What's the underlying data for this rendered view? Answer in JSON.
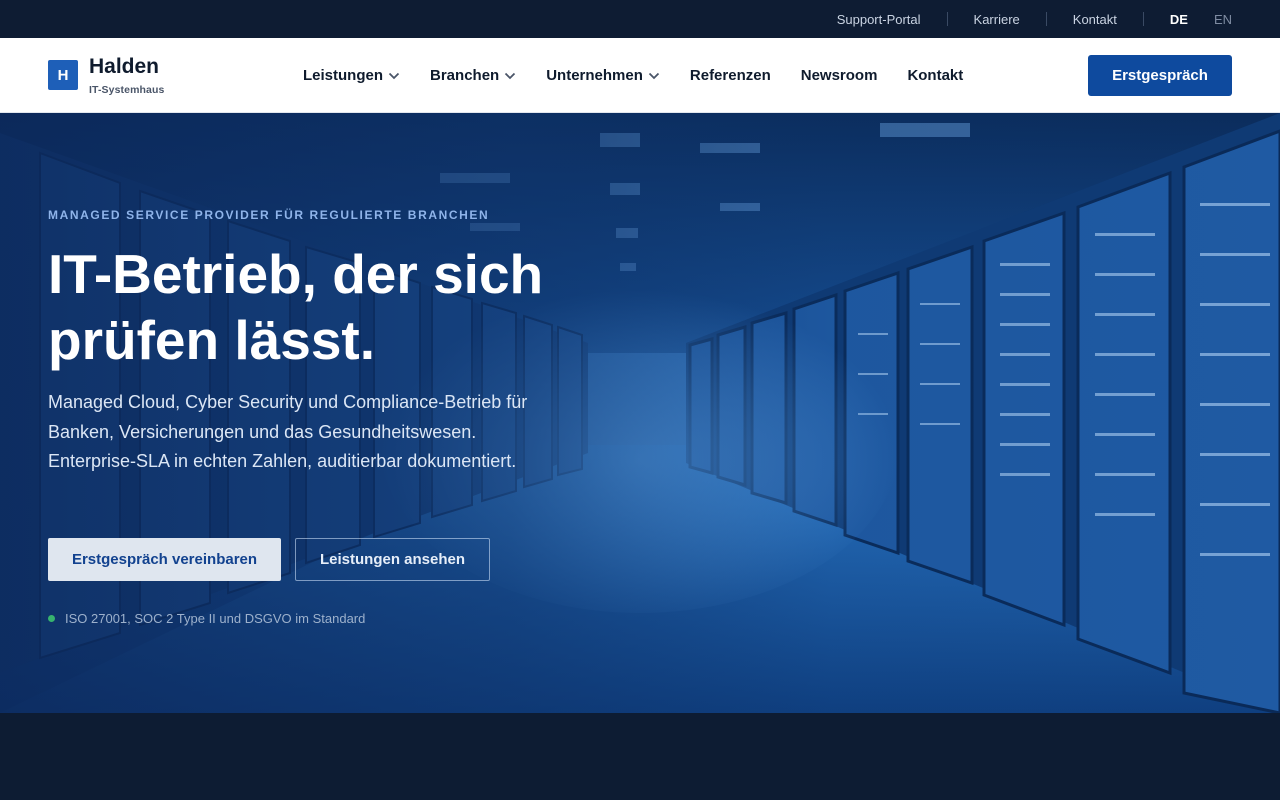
{
  "utility_nav": {
    "links": [
      "Support-Portal",
      "Karriere",
      "Kontakt"
    ],
    "languages": [
      {
        "code": "DE",
        "active": true
      },
      {
        "code": "EN",
        "active": false
      }
    ]
  },
  "brand": {
    "mark": "H",
    "name": "Halden",
    "tagline": "IT-Systemhaus"
  },
  "main_nav": [
    {
      "label": "Leistungen",
      "has_dropdown": true
    },
    {
      "label": "Branchen",
      "has_dropdown": true
    },
    {
      "label": "Unternehmen",
      "has_dropdown": true
    },
    {
      "label": "Referenzen",
      "has_dropdown": false
    },
    {
      "label": "Newsroom",
      "has_dropdown": false
    },
    {
      "label": "Kontakt",
      "has_dropdown": false
    }
  ],
  "header_cta": "Erstgespräch",
  "hero": {
    "eyebrow": "MANAGED SERVICE PROVIDER FÜR REGULIERTE BRANCHEN",
    "headline_line1": "IT-Betrieb, der sich",
    "headline_line2": "prüfen lässt.",
    "lead": "Managed Cloud, Cyber Security und Compliance-Betrieb für Banken, Versicherungen und das Gesundheitswesen. Enterprise-SLA in echten Zahlen, auditierbar dokumentiert.",
    "primary_button": "Erstgespräch vereinbaren",
    "secondary_button": "Leistungen ansehen",
    "trust_note": "ISO 27001, SOC 2 Type II und DSGVO im Standard",
    "background_image": "server-room-corridor"
  },
  "colors": {
    "utility_bar": "#0e1c33",
    "brand_blue": "#1e5fb8",
    "cta_blue": "#0e4a9e",
    "status_green": "#37b36e"
  }
}
